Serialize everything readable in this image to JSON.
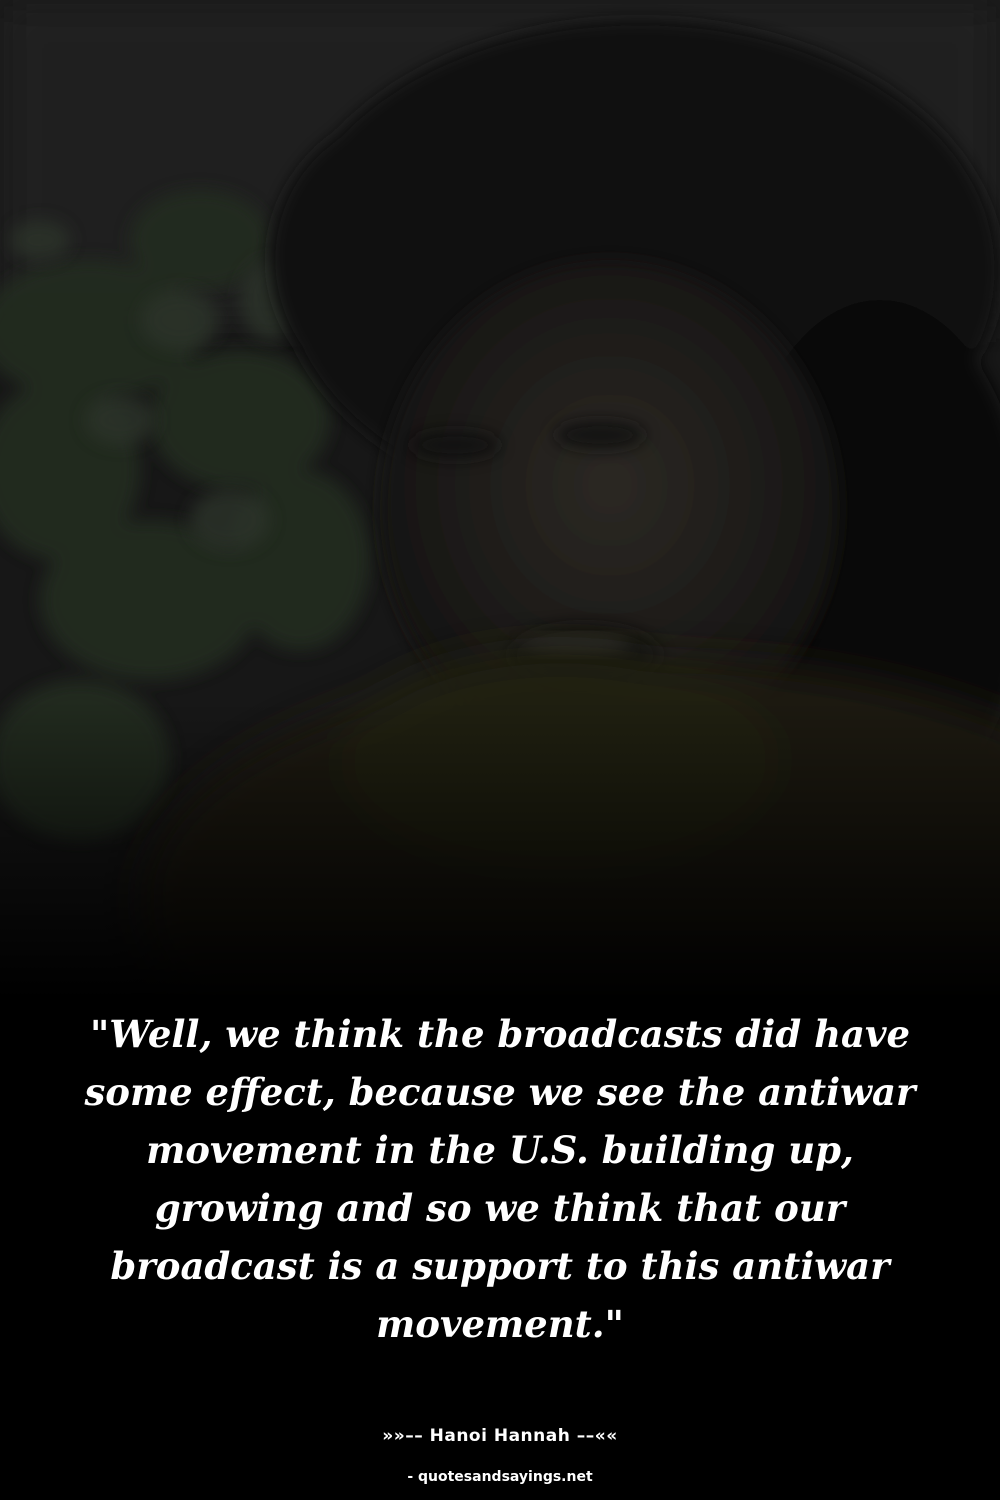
{
  "quote": {
    "text": "\"Well, we think the broadcasts did have some effect, because we see the antiwar movement in the U.S. building up, growing and so we think that our broadcast is a support to this antiwar movement.\""
  },
  "attribution": {
    "author_line": "»»–– Hanoi Hannah ––««",
    "source": "- quotesandsayings.net"
  },
  "colors": {
    "background": "#000000",
    "text": "#ffffff"
  }
}
